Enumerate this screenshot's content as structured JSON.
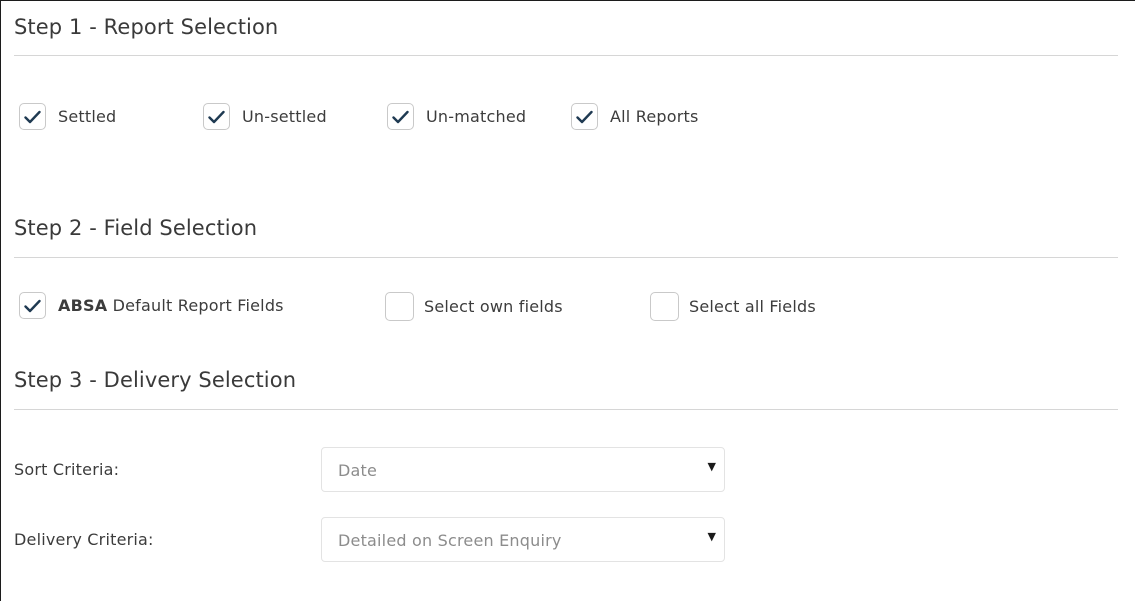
{
  "step1": {
    "title": "Step 1 - Report Selection",
    "options": [
      {
        "label": "Settled",
        "checked": true
      },
      {
        "label": "Un-settled",
        "checked": true
      },
      {
        "label": "Un-matched",
        "checked": true
      },
      {
        "label": "All Reports",
        "checked": true
      }
    ]
  },
  "step2": {
    "title": "Step 2 - Field Selection",
    "options": [
      {
        "label_bold": "ABSA",
        "label": " Default Report Fields",
        "checked": true
      },
      {
        "label": "Select own fields",
        "checked": false
      },
      {
        "label": "Select all Fields",
        "checked": false
      }
    ]
  },
  "step3": {
    "title": "Step 3 - Delivery Selection",
    "sort": {
      "label": "Sort Criteria:",
      "value": "Date"
    },
    "delivery": {
      "label": "Delivery Criteria:",
      "value": "Detailed on Screen Enquiry"
    }
  },
  "icons": {
    "check": "checkmark-icon",
    "caret": "caret-down-icon"
  },
  "colors": {
    "checkmark": "#1f3a52",
    "divider": "#d6d6d6",
    "select_text": "#8c8c8c"
  }
}
